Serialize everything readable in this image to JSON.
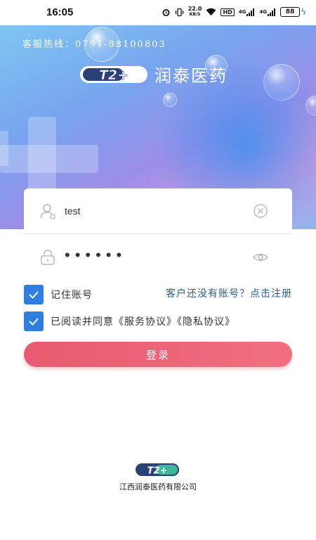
{
  "status_bar": {
    "time": "16:05",
    "net_speed_value": "22.0",
    "net_speed_unit": "KB/S",
    "hd_label": "HD",
    "signal_1": "4G",
    "signal_2": "4G",
    "battery": "88"
  },
  "banner": {
    "hotline": "客服热线：0791-88100803",
    "logo_mark": "T2+",
    "brand_name": "润泰医药"
  },
  "login_form": {
    "username_value": "test",
    "password_dots": "••••••"
  },
  "options": {
    "remember_label": "记住账号",
    "register_link": "客户还没有账号？点击注册",
    "agreement_label": "已阅读并同意《服务协议》《隐私协议》"
  },
  "login_button": "登录",
  "footer": {
    "logo_mark": "T2+",
    "company_name": "江西润泰医药有限公司"
  },
  "colors": {
    "accent_blue": "#2f7fe0",
    "button_red": "#e85a6f",
    "link_blue": "#2a5c8a"
  }
}
